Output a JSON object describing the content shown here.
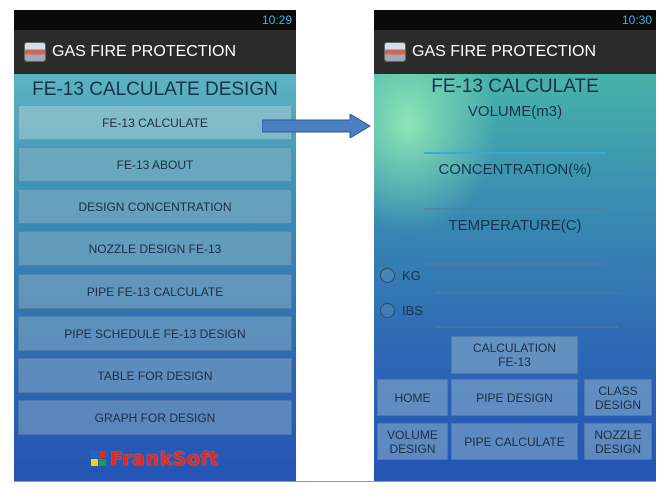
{
  "left": {
    "status_time": "10:29",
    "app_title": "GAS FIRE PROTECTION",
    "screen_title": "FE-13 CALCULATE DESIGN",
    "menu": [
      "FE-13 CALCULATE",
      "FE-13 ABOUT",
      "DESIGN CONCENTRATION",
      "NOZZLE DESIGN FE-13",
      "PIPE FE-13 CALCULATE",
      "PIPE SCHEDULE FE-13 DESIGN",
      "TABLE FOR DESIGN",
      "GRAPH FOR DESIGN"
    ],
    "logo_text": "FrankSoft",
    "logo_colors": [
      "#e8261c",
      "#1f62d6",
      "#f2d21a",
      "#2c9a3a"
    ]
  },
  "right": {
    "status_time": "10:30",
    "app_title": "GAS FIRE PROTECTION",
    "screen_title": "FE-13 CALCULATE",
    "volume_label": "VOLUME(m3)",
    "volume_value": "",
    "concentration_label": "CONCENTRATION(%)",
    "concentration_value": "",
    "temperature_label": "TEMPERATURE(C)",
    "temperature_value": "",
    "unit_kg": "KG",
    "unit_lbs": "IBS",
    "calc_button": "CALCULATION\nFE-13",
    "nav": {
      "home": "HOME",
      "pipe_design": "PIPE DESIGN",
      "class_design": "CLASS\nDESIGN",
      "volume_design": "VOLUME\nDESIGN",
      "pipe_calculate": "PIPE CALCULATE",
      "nozzle_design": "NOZZLE\nDESIGN"
    }
  },
  "colors": {
    "status_accent": "#39b7e6",
    "arrow_fill": "#4a7fc1",
    "input_focus": "#3aa8d8"
  }
}
